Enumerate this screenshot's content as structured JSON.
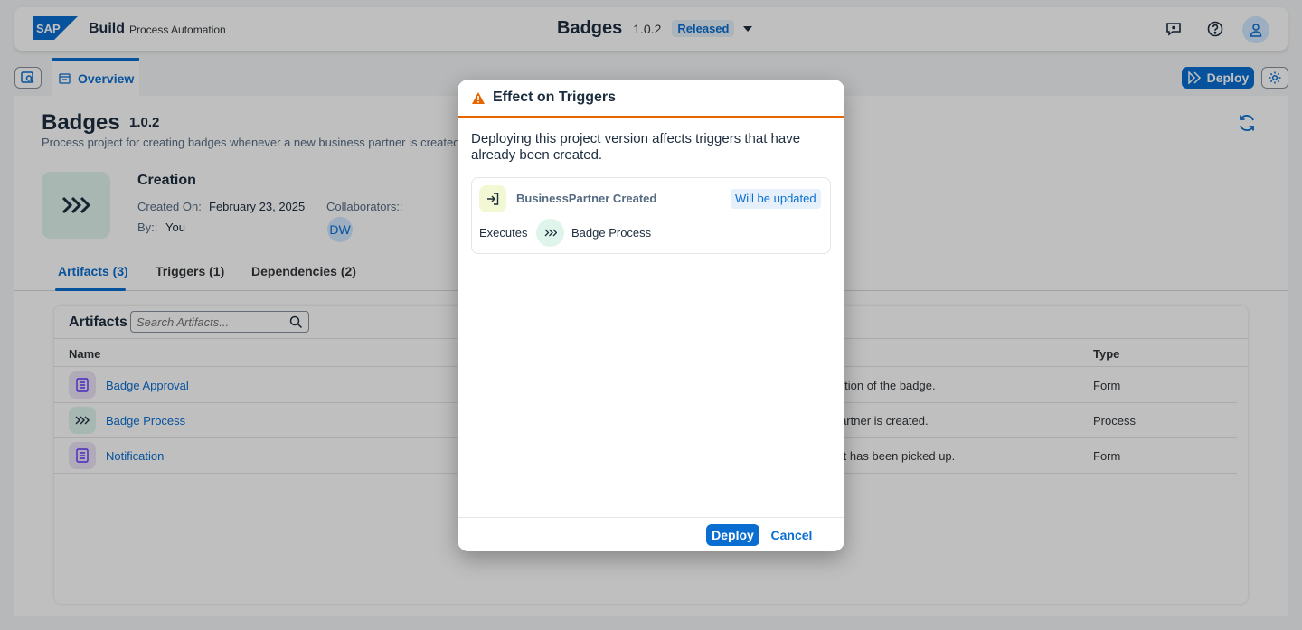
{
  "shell": {
    "logo_text": "SAP",
    "brand": "Build",
    "product": "Process Automation",
    "title": "Badges",
    "version": "1.0.2",
    "status": "Released",
    "icons": [
      "feedback-icon",
      "help-icon",
      "user-icon"
    ]
  },
  "tabs": {
    "overview": "Overview"
  },
  "toolbar": {
    "deploy_label": "Deploy"
  },
  "project": {
    "name": "Badges",
    "version": "1.0.2",
    "description": "Process project for creating badges whenever a new business partner is created.",
    "section": "Creation",
    "created_on_label": "Created On:",
    "created_on_value": "February 23, 2025",
    "by_label": "By::",
    "by_value": "You",
    "collaborators_label": "Collaborators::",
    "collaborator_initials": "DW"
  },
  "subtabs": [
    {
      "label": "Artifacts (3)",
      "active": true
    },
    {
      "label": "Triggers (1)",
      "active": false
    },
    {
      "label": "Dependencies (2)",
      "active": false
    }
  ],
  "artifacts": {
    "title": "Artifacts",
    "search_placeholder": "Search Artifacts...",
    "columns": {
      "name": "Name",
      "type": "Type"
    },
    "rows": [
      {
        "name": "Badge Approval",
        "description": "r rejection of the badge.",
        "type": "Form",
        "icon": "form-icon"
      },
      {
        "name": "Badge Process",
        "description": "ess partner is created.",
        "type": "Process",
        "icon": "process-icon"
      },
      {
        "name": "Notification",
        "description": "ate if it has been picked up.",
        "type": "Form",
        "icon": "form-icon"
      }
    ]
  },
  "dialog": {
    "title": "Effect on Triggers",
    "message": "Deploying this project version affects triggers that have already been created.",
    "trigger_name": "BusinessPartner Created",
    "trigger_status": "Will be updated",
    "executes_label": "Executes",
    "process_name": "Badge Process",
    "deploy_label": "Deploy",
    "cancel_label": "Cancel"
  },
  "colors": {
    "accent": "#0a6ed1",
    "warning": "#e76500",
    "form_icon_bg": "#ece4f7",
    "process_icon_bg": "#dff5ec"
  }
}
